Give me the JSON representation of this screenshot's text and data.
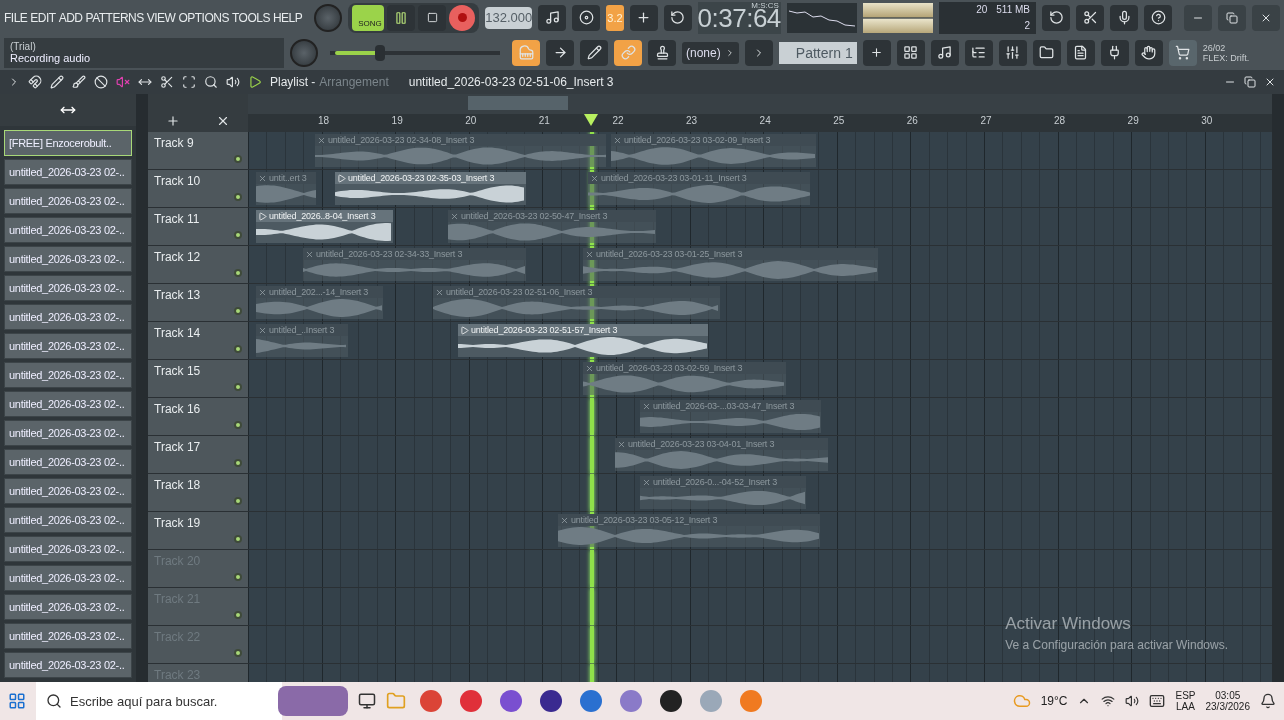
{
  "menu": [
    "FILE",
    "EDIT",
    "ADD",
    "PATTERNS",
    "VIEW",
    "OPTIONS",
    "TOOLS",
    "HELP"
  ],
  "hint": {
    "title": "(Trial)",
    "text": "Recording audio"
  },
  "transport": {
    "song_mode": {
      "label": "SONG",
      "selected": true
    },
    "recording": true,
    "tempo": "132.000",
    "snap": "3.2",
    "time": "0:37:64",
    "time_format": "M:S:CS"
  },
  "cpu": {
    "value": "20",
    "memory": "511 MB",
    "voices": "2"
  },
  "master_volume": {
    "level": 0.28
  },
  "channel_select": "(none)",
  "pattern": {
    "name": "Pattern 1"
  },
  "news": {
    "date": "26/02",
    "text": "FLEX: Drift."
  },
  "playlist": {
    "title": "Playlist -",
    "view": "Arrangement",
    "clip": "untitled_2026-03-23 02-51-06_Insert 3",
    "browser": [
      {
        "label": "[FREE] Enzocerobult..",
        "selected": true
      },
      {
        "label": "untitled_2026-03-23 02-..",
        "selected": false
      },
      {
        "label": "untitled_2026-03-23 02-..",
        "selected": false
      },
      {
        "label": "untitled_2026-03-23 02-..",
        "selected": false
      },
      {
        "label": "untitled_2026-03-23 02-..",
        "selected": false
      },
      {
        "label": "untitled_2026-03-23 02-..",
        "selected": false
      },
      {
        "label": "untitled_2026-03-23 02-..",
        "selected": false
      },
      {
        "label": "untitled_2026-03-23 02-..",
        "selected": false
      },
      {
        "label": "untitled_2026-03-23 02-..",
        "selected": false
      },
      {
        "label": "untitled_2026-03-23 02-..",
        "selected": false
      },
      {
        "label": "untitled_2026-03-23 02-..",
        "selected": false
      },
      {
        "label": "untitled_2026-03-23 02-..",
        "selected": false
      },
      {
        "label": "untitled_2026-03-23 02-..",
        "selected": false
      },
      {
        "label": "untitled_2026-03-23 02-..",
        "selected": false
      },
      {
        "label": "untitled_2026-03-23 02-..",
        "selected": false
      },
      {
        "label": "untitled_2026-03-23 02-..",
        "selected": false
      },
      {
        "label": "untitled_2026-03-23 02-..",
        "selected": false
      },
      {
        "label": "untitled_2026-03-23 02-..",
        "selected": false
      },
      {
        "label": "untitled_2026-03-23 02-..",
        "selected": false
      }
    ],
    "ruler": [
      "18",
      "19",
      "20",
      "21",
      "22",
      "23",
      "24",
      "25",
      "26",
      "27",
      "28",
      "29",
      "30"
    ],
    "tracks": [
      {
        "name": "Track 9",
        "dim": false,
        "clips": [
          {
            "name": "untitled_2026-03-23 02-34-08_Insert 3",
            "muted": true
          },
          {
            "name": "untitled_2026-03-23 03-02-09_Insert 3",
            "muted": true
          }
        ]
      },
      {
        "name": "Track 10",
        "dim": false,
        "clips": [
          {
            "name": "untit..ert 3",
            "muted": true
          },
          {
            "name": "untitled_2026-03-23 02-35-03_Insert 3",
            "muted": false
          },
          {
            "name": "untitled_2026-03-23 03-01-11_Insert 3",
            "muted": true
          }
        ]
      },
      {
        "name": "Track 11",
        "dim": false,
        "clips": [
          {
            "name": "untitled_2026..8-04_Insert 3",
            "muted": false
          },
          {
            "name": "untitled_2026-03-23 02-50-47_Insert 3",
            "muted": true
          }
        ]
      },
      {
        "name": "Track 12",
        "dim": false,
        "clips": [
          {
            "name": "untitled_2026-03-23 02-34-33_Insert 3",
            "muted": true
          },
          {
            "name": "untitled_2026-03-23 03-01-25_Insert 3",
            "muted": true
          }
        ]
      },
      {
        "name": "Track 13",
        "dim": false,
        "clips": [
          {
            "name": "untitled_202...-14_Insert 3",
            "muted": true
          },
          {
            "name": "untitled_2026-03-23 02-51-06_Insert 3",
            "muted": true
          }
        ]
      },
      {
        "name": "Track 14",
        "dim": false,
        "clips": [
          {
            "name": "untitled_..Insert 3",
            "muted": true
          },
          {
            "name": "untitled_2026-03-23 02-51-57_Insert 3",
            "muted": false
          }
        ]
      },
      {
        "name": "Track 15",
        "dim": false,
        "clips": [
          {
            "name": "untitled_2026-03-23 03-02-59_Insert 3",
            "muted": true
          }
        ]
      },
      {
        "name": "Track 16",
        "dim": false,
        "clips": [
          {
            "name": "untitled_2026-03-...03-03-47_Insert 3",
            "muted": true
          }
        ]
      },
      {
        "name": "Track 17",
        "dim": false,
        "clips": [
          {
            "name": "untitled_2026-03-23 03-04-01_Insert 3",
            "muted": true
          }
        ]
      },
      {
        "name": "Track 18",
        "dim": false,
        "clips": [
          {
            "name": "untitled_2026-0...-04-52_Insert 3",
            "muted": true
          }
        ]
      },
      {
        "name": "Track 19",
        "dim": false,
        "clips": [
          {
            "name": "untitled_2026-03-23 03-05-12_Insert 3",
            "muted": true
          }
        ]
      },
      {
        "name": "Track 20",
        "dim": true
      },
      {
        "name": "Track 21",
        "dim": true
      },
      {
        "name": "Track 22",
        "dim": true
      },
      {
        "name": "Track 23",
        "dim": true
      }
    ]
  },
  "watermark": {
    "title": "Activar Windows",
    "text": "Ve a Configuración para activar Windows."
  },
  "taskbar": {
    "search_placeholder": "Escribe aquí para buscar.",
    "temperature": "19°C",
    "language": "ESP",
    "layout": "LAA",
    "time": "03:05",
    "date": "23/3/2026"
  }
}
